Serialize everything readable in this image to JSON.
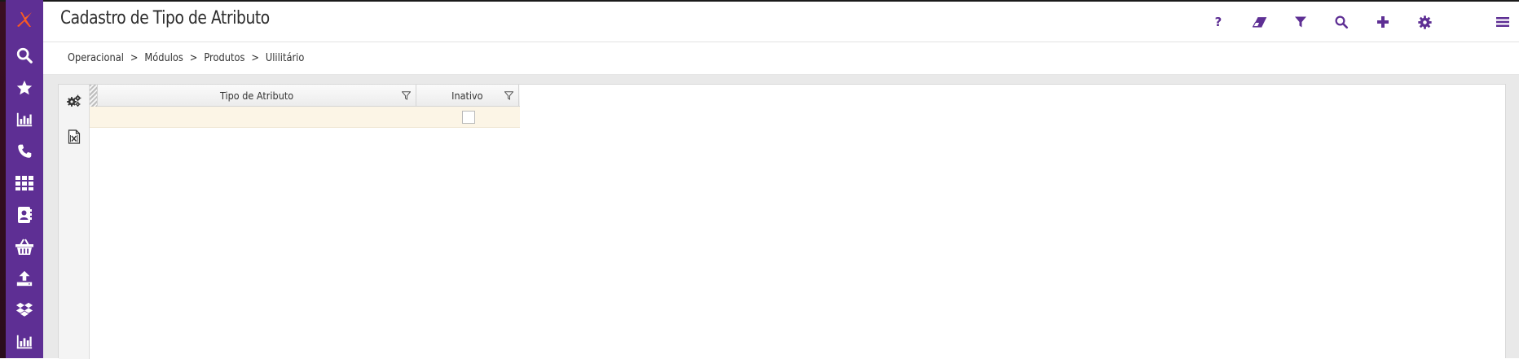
{
  "colors": {
    "sidebar": "#5e2f94",
    "accent": "#5e2f94",
    "logo_orange": "#ff5a1f",
    "row_highlight": "#fcf5e6",
    "page_background": "#e9e9e9"
  },
  "app": {
    "logo_icon": "logo-x-icon"
  },
  "sidebar": {
    "items": [
      {
        "icon": "search-icon"
      },
      {
        "icon": "star-icon"
      },
      {
        "icon": "bar-chart-icon"
      },
      {
        "icon": "phone-icon"
      },
      {
        "icon": "grid-icon"
      },
      {
        "icon": "contact-book-icon"
      },
      {
        "icon": "basket-icon"
      },
      {
        "icon": "upload-icon"
      },
      {
        "icon": "dropbox-icon"
      },
      {
        "icon": "bar-chart-icon"
      }
    ]
  },
  "header": {
    "title": "Cadastro de Tipo de Atributo",
    "toolbar": [
      {
        "icon": "help-icon",
        "label": "?"
      },
      {
        "icon": "eraser-icon"
      },
      {
        "icon": "filter-icon"
      },
      {
        "icon": "search-icon"
      },
      {
        "icon": "plus-icon"
      },
      {
        "icon": "gear-icon"
      },
      {
        "icon": "menu-icon"
      }
    ]
  },
  "breadcrumb": {
    "items": [
      "Operacional",
      "Módulos",
      "Produtos",
      "Ulilitário"
    ],
    "separator": ">"
  },
  "panel": {
    "tools": [
      {
        "icon": "gears-icon"
      },
      {
        "icon": "excel-export-icon"
      }
    ]
  },
  "grid": {
    "columns": [
      {
        "label": "Tipo de Atributo"
      },
      {
        "label": "Inativo"
      }
    ],
    "rows": [
      {
        "tipo": "",
        "inativo": false
      }
    ]
  }
}
